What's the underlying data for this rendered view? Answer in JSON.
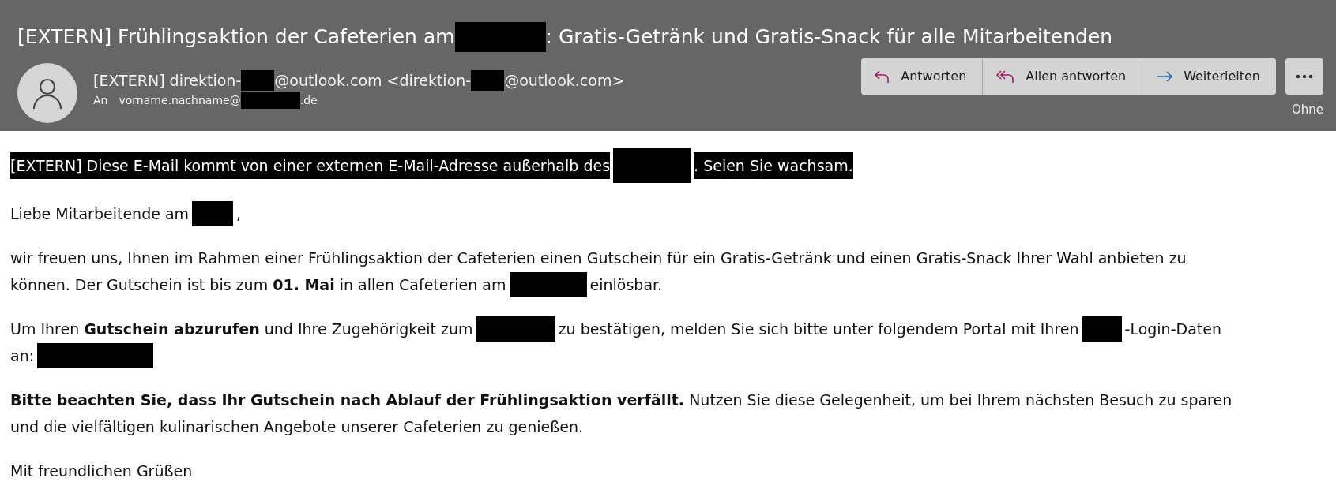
{
  "subject": [
    {
      "kind": "text",
      "text": "[EXTERN] Frühlingsaktion der Cafeterien am"
    },
    {
      "kind": "redacted"
    },
    {
      "kind": "text",
      "text": ": Gratis-Getränk und Gratis-Snack für alle Mitarbeitenden"
    }
  ],
  "sender": [
    {
      "kind": "text",
      "text": "[EXTERN] direktion-"
    },
    {
      "kind": "redacted"
    },
    {
      "kind": "text",
      "text": "@outlook.com <direktion-"
    },
    {
      "kind": "redacted"
    },
    {
      "kind": "text",
      "text": "@outlook.com>"
    }
  ],
  "to_label": "An",
  "recipient": [
    {
      "kind": "text",
      "text": "vorname.nachname@"
    },
    {
      "kind": "redacted"
    },
    {
      "kind": "text",
      "text": ".de"
    }
  ],
  "actions": [
    {
      "label": "Antworten"
    },
    {
      "label": "Allen antworten"
    },
    {
      "label": "Weiterleiten"
    }
  ],
  "more_label": "Ohne",
  "banner": [
    {
      "kind": "text",
      "text": "[EXTERN] Diese E-Mail kommt von einer externen E-Mail-Adresse außerhalb des"
    },
    {
      "kind": "redacted"
    },
    {
      "kind": "text",
      "text": ". Seien Sie wachsam."
    }
  ],
  "paragraphs": [
    [
      [
        {
          "kind": "text",
          "text": "Liebe Mitarbeitende am"
        },
        {
          "kind": "redacted"
        },
        {
          "kind": "text",
          "text": ","
        }
      ]
    ],
    [
      [
        {
          "kind": "text",
          "text": "wir freuen uns, Ihnen im Rahmen einer Frühlingsaktion der Cafeterien einen Gutschein für ein Gratis-Getränk und einen Gratis-Snack Ihrer Wahl anbieten zu"
        }
      ],
      [
        {
          "kind": "text",
          "text": "können. Der Gutschein ist bis zum **01. Mai** in allen Cafeterien am"
        },
        {
          "kind": "redacted"
        },
        {
          "kind": "text",
          "text": "einlösbar."
        }
      ]
    ],
    [
      [
        {
          "kind": "text",
          "text": "Um Ihren **Gutschein abzurufen** und Ihre Zugehörigkeit zum"
        },
        {
          "kind": "redacted"
        },
        {
          "kind": "text",
          "text": "zu bestätigen, melden Sie sich bitte unter folgendem Portal mit Ihren"
        },
        {
          "kind": "redacted"
        },
        {
          "kind": "text",
          "text": "-Login-Daten"
        }
      ],
      [
        {
          "kind": "text",
          "text": "an:"
        },
        {
          "kind": "redacted"
        }
      ]
    ],
    [
      [
        {
          "kind": "text",
          "text": "**Bitte beachten Sie, dass Ihr Gutschein nach Ablauf der Frühlingsaktion verfällt.** Nutzen Sie diese Gelegenheit, um bei Ihrem nächsten Besuch zu sparen"
        }
      ],
      [
        {
          "kind": "text",
          "text": "und die vielfältigen kulinarischen Angebote unserer Cafeterien zu genießen."
        }
      ]
    ],
    [
      [
        {
          "kind": "text",
          "text": "Mit freundlichen Grüßen"
        }
      ]
    ]
  ]
}
